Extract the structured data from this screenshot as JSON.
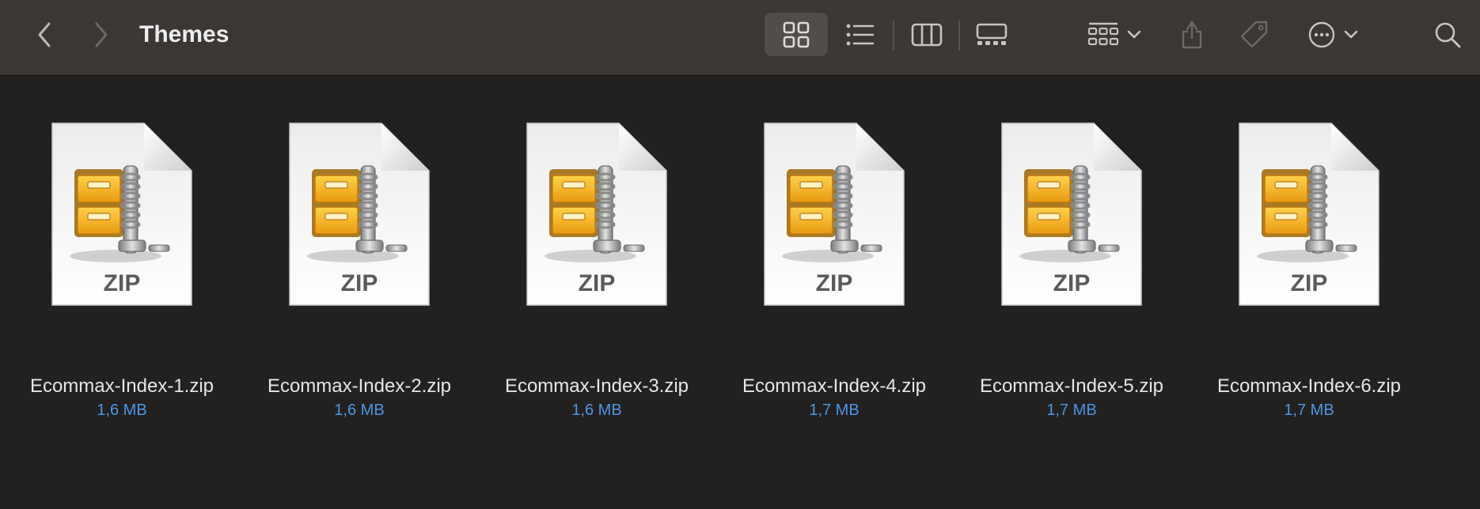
{
  "window": {
    "title": "Themes"
  },
  "toolbar": {
    "back": "back-icon",
    "forward": "forward-icon",
    "views": [
      "icon-view",
      "list-view",
      "column-view",
      "gallery-view"
    ],
    "active_view": "icon-view",
    "group": "group-icon",
    "share": "share-icon",
    "tag": "tag-icon",
    "more": "more-icon",
    "search": "search-icon"
  },
  "files": [
    {
      "name": "Ecommax-Index-1.zip",
      "size": "1,6 MB",
      "badge": "ZIP"
    },
    {
      "name": "Ecommax-Index-2.zip",
      "size": "1,6 MB",
      "badge": "ZIP"
    },
    {
      "name": "Ecommax-Index-3.zip",
      "size": "1,6 MB",
      "badge": "ZIP"
    },
    {
      "name": "Ecommax-Index-4.zip",
      "size": "1,7 MB",
      "badge": "ZIP"
    },
    {
      "name": "Ecommax-Index-5.zip",
      "size": "1,7 MB",
      "badge": "ZIP"
    },
    {
      "name": "Ecommax-Index-6.zip",
      "size": "1,7 MB",
      "badge": "ZIP"
    }
  ],
  "colors": {
    "background": "#232020",
    "toolbar": "#3b3735",
    "size_text": "#4a97e8"
  }
}
